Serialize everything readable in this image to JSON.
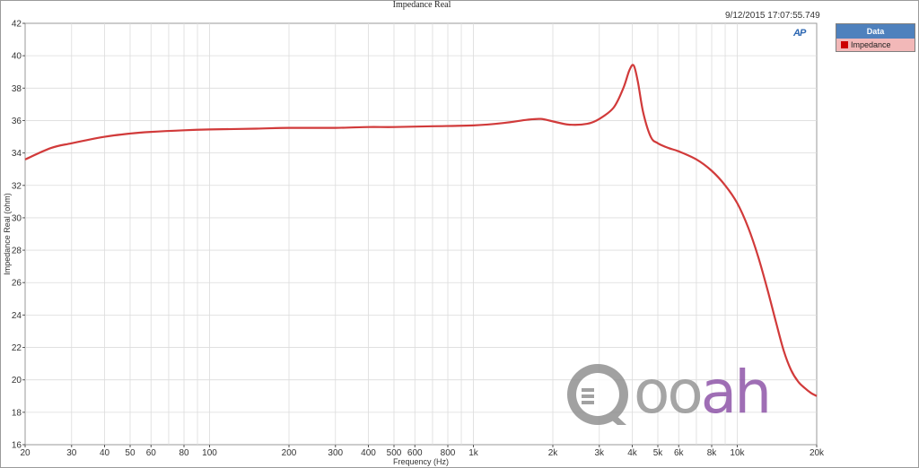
{
  "title": "Impedance Real",
  "timestamp": "9/12/2015 17:07:55.749",
  "legend": {
    "header": "Data",
    "items": [
      {
        "label": "Impedance",
        "color": "#cc0000"
      }
    ]
  },
  "logo_text": "AP",
  "watermark": {
    "text_gray": "oo",
    "text_purple": "ah"
  },
  "colors": {
    "line": "#d13a3a",
    "grid": "#dcdcdc",
    "legend_header": "#4f81bd",
    "legend_item_bg": "#f2b8b8"
  },
  "chart_data": {
    "type": "line",
    "title": "Impedance Real",
    "xlabel": "Frequency (Hz)",
    "ylabel": "Impedance Real (ohm)",
    "xscale": "log",
    "xlim": [
      20,
      20000
    ],
    "ylim": [
      16,
      42
    ],
    "yticks": [
      16,
      18,
      20,
      22,
      24,
      26,
      28,
      30,
      32,
      34,
      36,
      38,
      40,
      42
    ],
    "xticks": [
      {
        "value": 20,
        "label": "20"
      },
      {
        "value": 30,
        "label": "30"
      },
      {
        "value": 40,
        "label": "40"
      },
      {
        "value": 50,
        "label": "50"
      },
      {
        "value": 60,
        "label": "60"
      },
      {
        "value": 80,
        "label": "80"
      },
      {
        "value": 100,
        "label": "100"
      },
      {
        "value": 200,
        "label": "200"
      },
      {
        "value": 300,
        "label": "300"
      },
      {
        "value": 400,
        "label": "400"
      },
      {
        "value": 500,
        "label": "500"
      },
      {
        "value": 600,
        "label": "600"
      },
      {
        "value": 800,
        "label": "800"
      },
      {
        "value": 1000,
        "label": "1k"
      },
      {
        "value": 2000,
        "label": "2k"
      },
      {
        "value": 3000,
        "label": "3k"
      },
      {
        "value": 4000,
        "label": "4k"
      },
      {
        "value": 5000,
        "label": "5k"
      },
      {
        "value": 6000,
        "label": "6k"
      },
      {
        "value": 8000,
        "label": "8k"
      },
      {
        "value": 10000,
        "label": "10k"
      },
      {
        "value": 20000,
        "label": "20k"
      }
    ],
    "grid": true,
    "legend_position": "right",
    "series": [
      {
        "name": "Impedance",
        "x": [
          20,
          25,
          30,
          40,
          50,
          60,
          80,
          100,
          150,
          200,
          300,
          400,
          500,
          700,
          1000,
          1300,
          1600,
          1800,
          2000,
          2300,
          2700,
          3000,
          3400,
          3700,
          3900,
          4050,
          4200,
          4400,
          4700,
          5000,
          5500,
          6000,
          7000,
          8000,
          9000,
          10000,
          11000,
          12000,
          13000,
          14000,
          15000,
          16000,
          17000,
          18000,
          19000,
          20000
        ],
        "y": [
          33.6,
          34.3,
          34.6,
          35.0,
          35.2,
          35.3,
          35.4,
          35.45,
          35.5,
          35.55,
          35.55,
          35.6,
          35.6,
          35.65,
          35.7,
          35.85,
          36.05,
          36.1,
          35.95,
          35.75,
          35.8,
          36.1,
          36.8,
          38.0,
          39.1,
          39.4,
          38.4,
          36.5,
          35.0,
          34.6,
          34.3,
          34.1,
          33.6,
          32.9,
          32.0,
          30.9,
          29.4,
          27.6,
          25.6,
          23.6,
          21.8,
          20.6,
          19.9,
          19.5,
          19.2,
          19.0
        ]
      }
    ]
  }
}
